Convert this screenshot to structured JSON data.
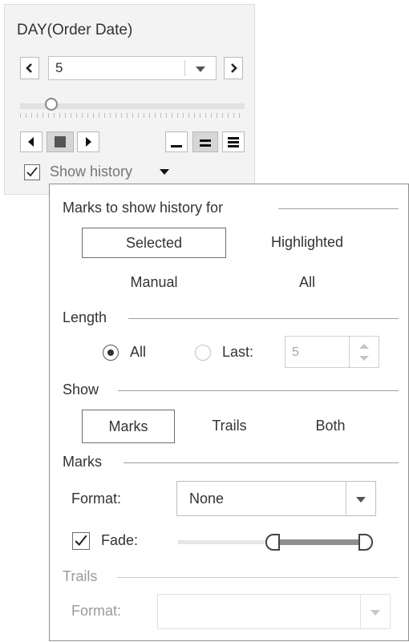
{
  "pages_card": {
    "title": "DAY(Order Date)",
    "selected_value": "5",
    "show_history_label": "Show history",
    "show_history_checked": true
  },
  "history_panel": {
    "marks_section": {
      "title": "Marks to show history for",
      "options": [
        "Selected",
        "Highlighted",
        "Manual",
        "All"
      ],
      "selected": "Selected"
    },
    "length_section": {
      "title": "Length",
      "all_label": "All",
      "last_label": "Last:",
      "last_value": "5",
      "selected": "All"
    },
    "show_section": {
      "title": "Show",
      "options": [
        "Marks",
        "Trails",
        "Both"
      ],
      "selected": "Marks"
    },
    "marks_format_section": {
      "title": "Marks",
      "format_label": "Format:",
      "format_value": "None",
      "fade_label": "Fade:",
      "fade_checked": true
    },
    "trails_section": {
      "title": "Trails",
      "format_label": "Format:",
      "format_value": ""
    }
  },
  "colors": {
    "card_bg": "#f3f3f3",
    "panel_border": "#8e8e8e",
    "disabled_text": "#9a9a9a"
  }
}
